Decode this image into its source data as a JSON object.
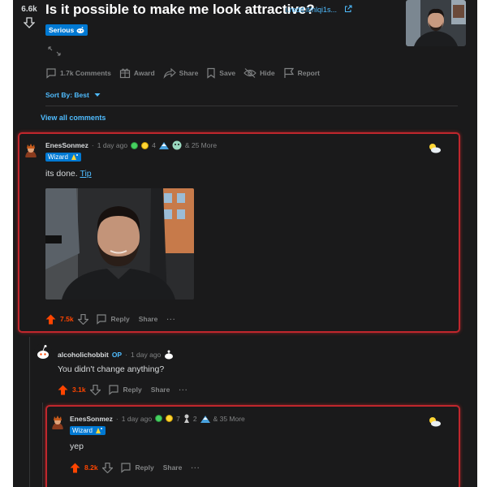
{
  "post": {
    "score": "6.6k",
    "title": "Is it possible to make me look attractive?",
    "domain": "i.redd.it/nlqi1s...",
    "flair": "Serious"
  },
  "actions": {
    "comments": "1.7k Comments",
    "award": "Award",
    "share": "Share",
    "save": "Save",
    "hide": "Hide",
    "report": "Report"
  },
  "sort_label": "Sort By: Best",
  "view_all": "View all comments",
  "comments": [
    {
      "user": "EnesSonmez",
      "time": "1 day ago",
      "award_count_1": "4",
      "more": "& 25 More",
      "flair": "Wizard",
      "body": "its done.",
      "link": "Tip",
      "votes": "7.5k",
      "reply": "Reply",
      "share": "Share"
    },
    {
      "user": "alcoholichobbit",
      "op": "OP",
      "time": "1 day ago",
      "body": "You didn't change anything?",
      "votes": "3.1k",
      "reply": "Reply",
      "share": "Share"
    },
    {
      "user": "EnesSonmez",
      "time": "1 day ago",
      "award_count_1": "7",
      "award_count_2": "2",
      "more": "& 35 More",
      "flair": "Wizard",
      "body": "yep",
      "votes": "8.2k",
      "reply": "Reply",
      "share": "Share"
    }
  ],
  "more_glyph": "···",
  "colors": {
    "background": "#1a1a1b",
    "accent": "#4fbcff",
    "upvote": "#ff4500",
    "highlight": "#c0272d",
    "flair": "#0079d3"
  }
}
